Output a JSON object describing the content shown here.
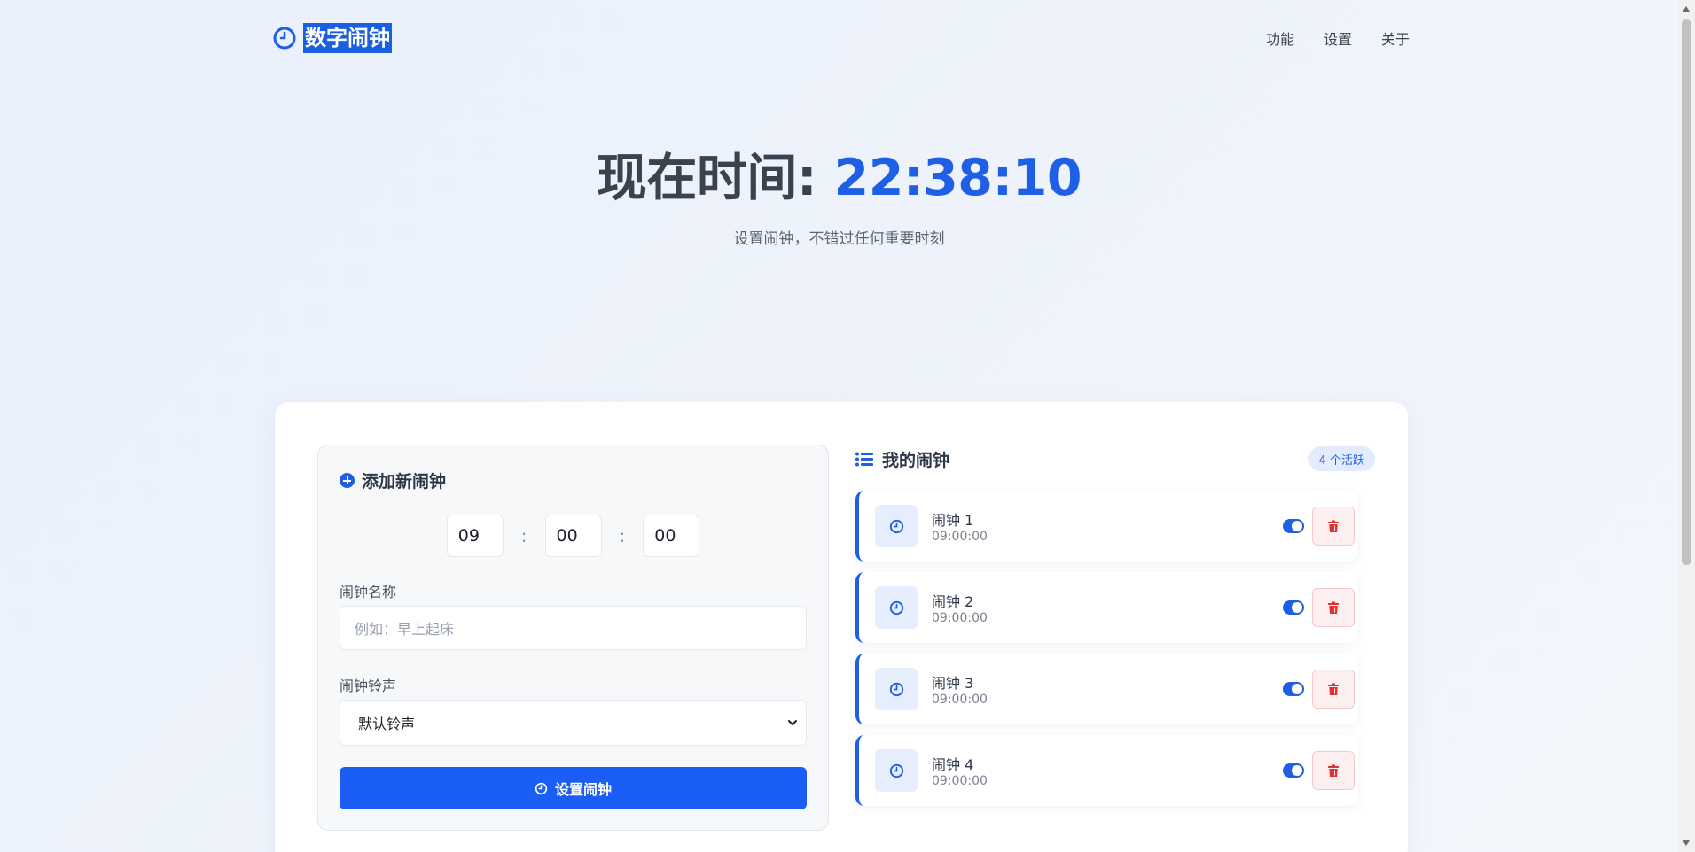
{
  "header": {
    "logo_text": "数字闹钟",
    "nav": [
      "功能",
      "设置",
      "关于"
    ]
  },
  "hero": {
    "title_prefix": "现在时间: ",
    "current_time": "22:38:10",
    "subtitle": "设置闹钟，不错过任何重要时刻"
  },
  "add_alarm": {
    "heading": "添加新闹钟",
    "hour": "09",
    "minute": "00",
    "second": "00",
    "separator": ":",
    "name_label": "闹钟名称",
    "name_placeholder": "例如：早上起床",
    "sound_label": "闹钟铃声",
    "sound_selected": "默认铃声",
    "submit_label": "设置闹钟"
  },
  "alarm_list": {
    "heading": "我的闹钟",
    "badge": "4 个活跃",
    "items": [
      {
        "name": "闹钟 1",
        "time": "09:00:00",
        "enabled": true
      },
      {
        "name": "闹钟 2",
        "time": "09:00:00",
        "enabled": true
      },
      {
        "name": "闹钟 3",
        "time": "09:00:00",
        "enabled": true
      },
      {
        "name": "闹钟 4",
        "time": "09:00:00",
        "enabled": true
      }
    ]
  },
  "icons": {
    "logo": "clock-icon",
    "add": "plus-circle-icon",
    "list": "list-icon",
    "alarm": "clock-icon",
    "delete": "trash-icon",
    "submit": "clock-icon",
    "select": "chevron-down-icon"
  },
  "colors": {
    "accent": "#1f5fe6",
    "button": "#1a5ef5",
    "danger": "#e03131",
    "danger_bg": "#fdeff0"
  }
}
